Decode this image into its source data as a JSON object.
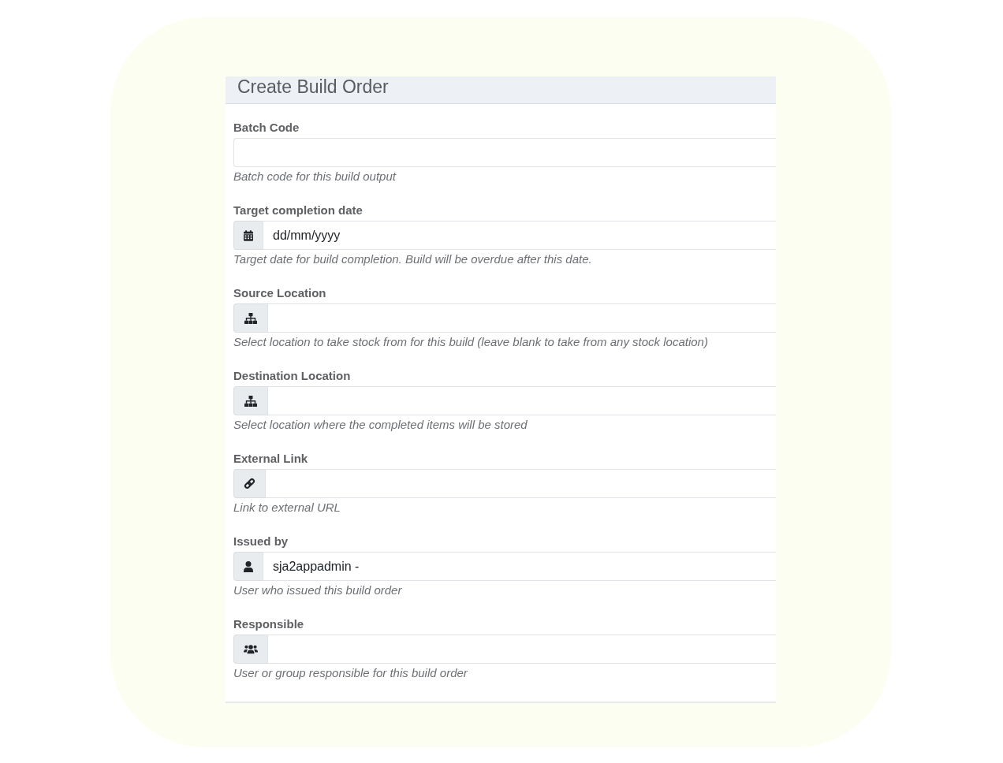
{
  "panel": {
    "title": "Create Build Order"
  },
  "fields": [
    {
      "kind": "text",
      "label": "Batch Code",
      "help": "Batch code for this build output"
    },
    {
      "kind": "date",
      "label": "Target completion date",
      "placeholder": "dd/mm/yyyy",
      "help": "Target date for build completion. Build will be overdue after this date."
    },
    {
      "kind": "location",
      "label": "Source Location",
      "help": "Select location to take stock from for this build (leave blank to take from any stock location)"
    },
    {
      "kind": "location",
      "label": "Destination Location",
      "help": "Select location where the completed items will be stored"
    },
    {
      "kind": "link",
      "label": "External Link",
      "help": "Link to external URL"
    },
    {
      "kind": "user",
      "label": "Issued by",
      "value": "sja2appadmin -",
      "help": "User who issued this build order"
    },
    {
      "kind": "owner",
      "label": "Responsible",
      "help": "User or group responsible for this build order"
    }
  ]
}
